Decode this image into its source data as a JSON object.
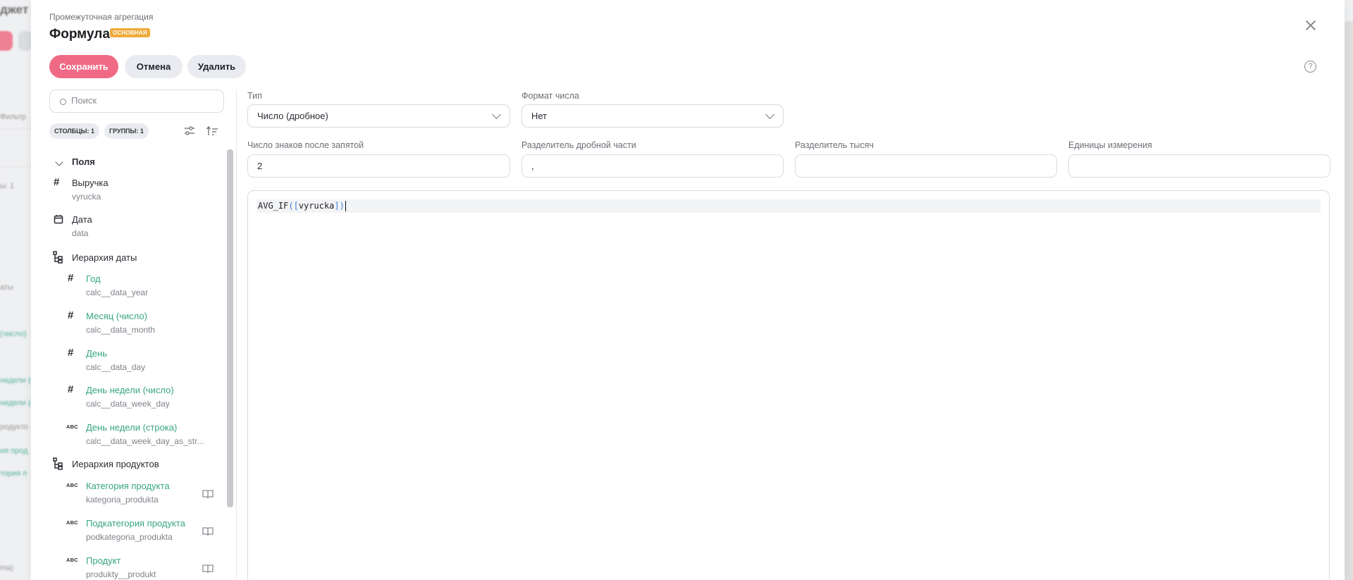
{
  "background": {
    "title": "джет",
    "texts": [
      {
        "t": "Фильтр",
        "green": false
      },
      {
        "t": "ы: 1",
        "green": false
      },
      {
        "t": "аты",
        "green": false
      },
      {
        "t": "(число)",
        "green": true
      },
      {
        "t": "недели (ч",
        "green": true
      },
      {
        "t": "недели (с",
        "green": true
      },
      {
        "t": "родукто",
        "green": false
      },
      {
        "t": "ия прод",
        "green": true
      },
      {
        "t": "тория п",
        "green": true
      },
      {
        "t": "ma)",
        "green": false
      }
    ]
  },
  "modal": {
    "subtitle": "Промежуточная агрегация",
    "title": "Формула",
    "badge": "ОСНОВНАЯ",
    "buttons": {
      "save": "Сохранить",
      "cancel": "Отмена",
      "delete": "Удалить"
    },
    "help_symbol": "?"
  },
  "left_panel": {
    "search_placeholder": "Поиск",
    "chips": [
      "СТОЛБЦЫ: 1",
      "ГРУППЫ: 1"
    ],
    "tree": {
      "root_label": "Поля",
      "items": [
        {
          "icon": "hash-icon",
          "label": "Выручка",
          "sub": "vyrucka",
          "green": false,
          "indent": 0
        },
        {
          "icon": "calendar-icon",
          "label": "Дата",
          "sub": "data",
          "green": false,
          "indent": 0
        },
        {
          "icon": "hierarchy-icon",
          "label": "Иерархия даты",
          "sub": "",
          "green": false,
          "indent": 0
        },
        {
          "icon": "hash-icon",
          "label": "Год",
          "sub": "calc__data_year",
          "green": true,
          "indent": 1
        },
        {
          "icon": "hash-icon",
          "label": "Месяц (число)",
          "sub": "calc__data_month",
          "green": true,
          "indent": 1
        },
        {
          "icon": "hash-icon",
          "label": "День",
          "sub": "calc__data_day",
          "green": true,
          "indent": 1
        },
        {
          "icon": "hash-icon",
          "label": "День недели (число)",
          "sub": "calc__data_week_day",
          "green": true,
          "indent": 1
        },
        {
          "icon": "abc-icon",
          "label": "День недели (строка)",
          "sub": "calc__data_week_day_as_str...",
          "green": true,
          "indent": 1
        },
        {
          "icon": "hierarchy-icon",
          "label": "Иерархия продуктов",
          "sub": "",
          "green": false,
          "indent": 0
        },
        {
          "icon": "abc-icon",
          "label": "Категория продукта",
          "sub": "kategoria_produkta",
          "green": true,
          "indent": 1,
          "book": true
        },
        {
          "icon": "abc-icon",
          "label": "Подкатегория продукта",
          "sub": "podkategoria_produkta",
          "green": true,
          "indent": 1,
          "book": true
        },
        {
          "icon": "abc-icon",
          "label": "Продукт",
          "sub": "produkty__produkt",
          "green": true,
          "indent": 1,
          "book": true
        }
      ],
      "abc_text": "ABC",
      "hash_text": "#"
    }
  },
  "form": {
    "type_label": "Тип",
    "type_value": "Число (дробное)",
    "format_label": "Формат числа",
    "format_value": "Нет",
    "decimals_label": "Число знаков после запятой",
    "decimals_value": "2",
    "dec_sep_label": "Разделитель дробной части",
    "dec_sep_value": ",",
    "thousands_label": "Разделитель тысяч",
    "thousands_value": "",
    "units_label": "Единицы измерения",
    "units_value": ""
  },
  "editor": {
    "fn": "AVG_IF",
    "open": "(",
    "lb": "[",
    "arg": "vyrucka",
    "rb": "]",
    "close": ")"
  },
  "colors": {
    "accent": "#f06a85",
    "green": "#36a57f",
    "badge": "#eeaa3a"
  }
}
